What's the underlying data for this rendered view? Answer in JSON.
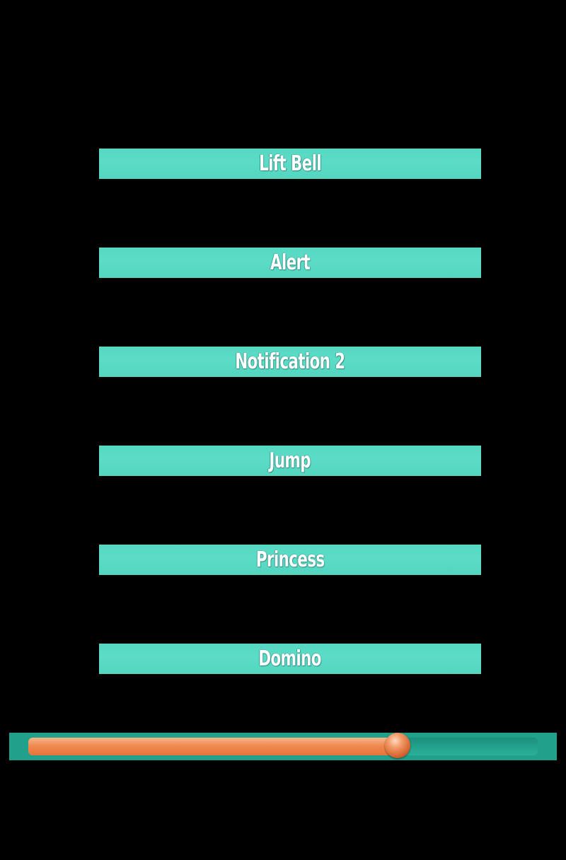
{
  "sounds": [
    {
      "label": "Lift Bell"
    },
    {
      "label": "Alert"
    },
    {
      "label": "Notification 2"
    },
    {
      "label": "Jump"
    },
    {
      "label": "Princess"
    },
    {
      "label": "Domino"
    }
  ],
  "player": {
    "progress": 0.725
  },
  "colors": {
    "background": "#000000",
    "button": "#55d8c2",
    "player_bar": "#21a08c",
    "progress_fill": "#f08a50"
  }
}
